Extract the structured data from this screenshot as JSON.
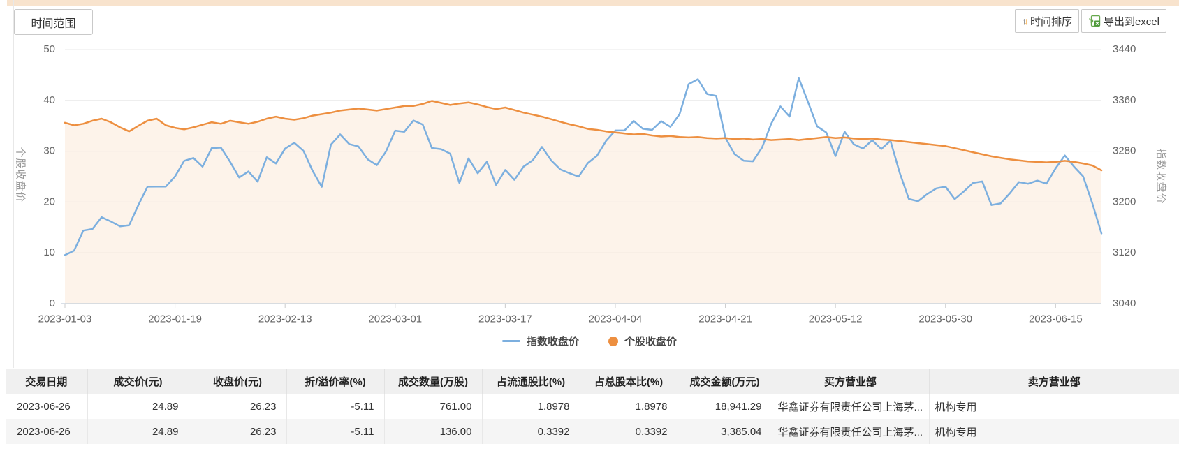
{
  "page": {
    "top_strip_color": "#f8e3cd"
  },
  "toolbar": {
    "time_range_label": "时间范围",
    "time_sort_label": "时间排序",
    "export_label": "导出到excel"
  },
  "chart_data": {
    "type": "line",
    "x_tick_labels": [
      "2023-01-03",
      "2023-01-19",
      "2023-02-13",
      "2023-03-01",
      "2023-03-17",
      "2023-04-04",
      "2023-04-21",
      "2023-05-12",
      "2023-05-30",
      "2023-06-15"
    ],
    "x_tick_indices": [
      0,
      12,
      24,
      36,
      48,
      60,
      72,
      84,
      96,
      108
    ],
    "left_axis": {
      "name": "个股收盘价",
      "min": 0,
      "max": 50,
      "ticks": [
        0,
        10,
        20,
        30,
        40,
        50
      ]
    },
    "right_axis": {
      "name": "指数收盘价",
      "min": 3040,
      "max": 3440,
      "ticks": [
        3040,
        3120,
        3200,
        3280,
        3360,
        3440
      ]
    },
    "grid": true,
    "legend_position": "bottom",
    "series": [
      {
        "name": "指数收盘价",
        "axis": "right",
        "color": "#7CAFDF",
        "marker": "line",
        "values": [
          3116.5,
          3123.5,
          3155.2,
          3157.6,
          3176.1,
          3169.5,
          3161.8,
          3163.5,
          3195.3,
          3224.2,
          3224.3,
          3224.4,
          3240.3,
          3264.8,
          3269.3,
          3255.7,
          3284.9,
          3285.7,
          3263.4,
          3238.7,
          3248.1,
          3232.1,
          3270.4,
          3260.7,
          3284.2,
          3293.3,
          3280.5,
          3249.0,
          3224.0,
          3290.3,
          3306.5,
          3291.2,
          3287.5,
          3267.2,
          3258.0,
          3279.6,
          3312.4,
          3310.7,
          3328.4,
          3322.0,
          3285.1,
          3283.3,
          3276.1,
          3230.1,
          3268.7,
          3245.3,
          3263.3,
          3226.9,
          3250.6,
          3234.9,
          3255.7,
          3265.8,
          3286.7,
          3265.7,
          3251.4,
          3245.4,
          3240.1,
          3261.3,
          3272.9,
          3296.4,
          3312.6,
          3312.6,
          3327.7,
          3315.4,
          3313.6,
          3327.2,
          3318.4,
          3338.2,
          3385.6,
          3393.3,
          3370.1,
          3367.0,
          3301.3,
          3275.4,
          3264.9,
          3264.1,
          3285.9,
          3323.3,
          3350.5,
          3334.5,
          3395.0,
          3357.7,
          3319.2,
          3309.6,
          3272.4,
          3310.7,
          3291.0,
          3284.2,
          3297.3,
          3283.5,
          3296.5,
          3246.2,
          3204.8,
          3201.3,
          3212.5,
          3221.5,
          3224.2,
          3204.6,
          3216.7,
          3230.1,
          3232.4,
          3195.3,
          3197.8,
          3213.6,
          3231.4,
          3228.8,
          3233.7,
          3229.0,
          3253.0,
          3273.3,
          3255.8,
          3240.4,
          3197.9,
          3150.6
        ]
      },
      {
        "name": "个股收盘价",
        "axis": "left",
        "color": "#ED8F40",
        "marker": "circle",
        "area": true,
        "area_fill": "rgba(237,143,64,0.11)",
        "values": [
          35.6,
          35.1,
          35.4,
          36.0,
          36.4,
          35.7,
          34.7,
          33.9,
          35.0,
          36.0,
          36.4,
          35.1,
          34.6,
          34.3,
          34.7,
          35.2,
          35.7,
          35.4,
          36.0,
          35.7,
          35.4,
          35.8,
          36.4,
          36.8,
          36.4,
          36.2,
          36.5,
          37.0,
          37.3,
          37.6,
          38.0,
          38.2,
          38.4,
          38.2,
          38.0,
          38.3,
          38.6,
          38.9,
          38.9,
          39.3,
          39.9,
          39.5,
          39.1,
          39.4,
          39.6,
          39.2,
          38.7,
          38.3,
          38.6,
          38.1,
          37.6,
          37.2,
          36.8,
          36.3,
          35.8,
          35.3,
          34.9,
          34.4,
          34.2,
          33.9,
          33.7,
          33.5,
          33.3,
          33.4,
          33.1,
          32.9,
          33.0,
          32.8,
          32.7,
          32.8,
          32.6,
          32.5,
          32.6,
          32.4,
          32.5,
          32.3,
          32.4,
          32.2,
          32.3,
          32.4,
          32.2,
          32.4,
          32.6,
          32.8,
          32.6,
          32.7,
          32.5,
          32.4,
          32.5,
          32.3,
          32.2,
          32.0,
          31.8,
          31.6,
          31.4,
          31.2,
          31.0,
          30.6,
          30.2,
          29.8,
          29.4,
          29.0,
          28.7,
          28.4,
          28.2,
          28.0,
          27.9,
          27.8,
          27.9,
          28.1,
          27.9,
          27.6,
          27.2,
          26.23
        ]
      }
    ]
  },
  "table": {
    "headers": [
      "交易日期",
      "成交价(元)",
      "收盘价(元)",
      "折/溢价率(%)",
      "成交数量(万股)",
      "占流通股比(%)",
      "占总股本比(%)",
      "成交金额(万元)",
      "买方营业部",
      "卖方营业部"
    ],
    "rows": [
      [
        "2023-06-26",
        "24.89",
        "26.23",
        "-5.11",
        "761.00",
        "1.8978",
        "1.8978",
        "18,941.29",
        "华鑫证券有限责任公司上海茅...",
        "机构专用"
      ],
      [
        "2023-06-26",
        "24.89",
        "26.23",
        "-5.11",
        "136.00",
        "0.3392",
        "0.3392",
        "3,385.04",
        "华鑫证券有限责任公司上海茅...",
        "机构专用"
      ]
    ]
  }
}
